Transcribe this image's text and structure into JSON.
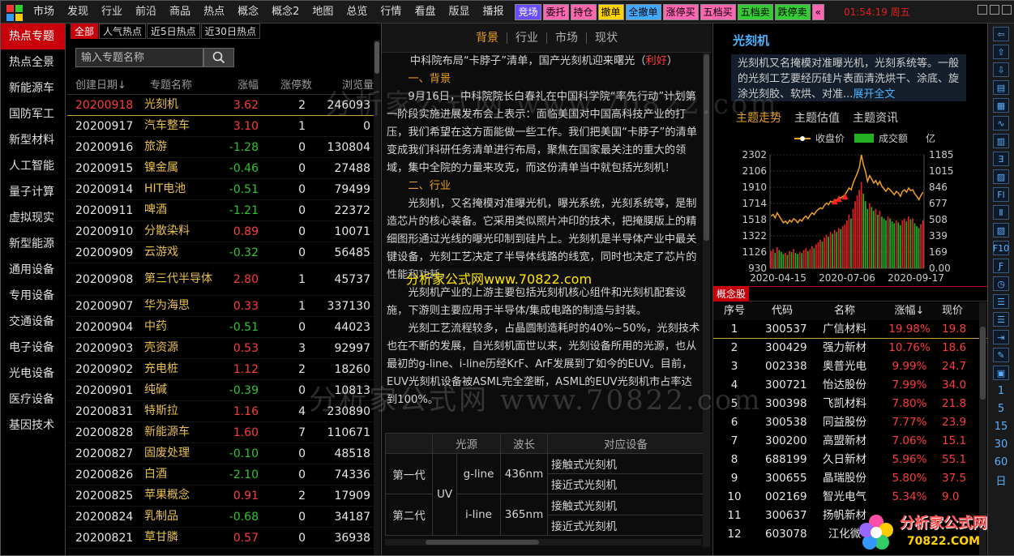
{
  "menu": [
    "市场",
    "发现",
    "行业",
    "前沿",
    "商品",
    "热点",
    "概念",
    "概念2",
    "地图",
    "总览",
    "行情",
    "看盘",
    "版显",
    "播报"
  ],
  "quick_buttons": [
    {
      "label": "竞场",
      "bg": "#6a4cff",
      "fg": "#ffffff"
    },
    {
      "label": "委托",
      "bg": "#ff66b2",
      "fg": "#000000"
    },
    {
      "label": "持仓",
      "bg": "#ff66b2",
      "fg": "#000000"
    },
    {
      "label": "撤单",
      "bg": "#ffd400",
      "fg": "#000000"
    },
    {
      "label": "全撤单",
      "bg": "#3fa9ff",
      "fg": "#000000"
    },
    {
      "label": "涨停买",
      "bg": "#ff66b2",
      "fg": "#000000"
    },
    {
      "label": "五档买",
      "bg": "#ff66b2",
      "fg": "#000000"
    },
    {
      "label": "五档卖",
      "bg": "#33cc33",
      "fg": "#000000"
    },
    {
      "label": "跌停卖",
      "bg": "#33cc33",
      "fg": "#000000"
    },
    {
      "label": "«",
      "bg": "#ff66b2",
      "fg": "#000000"
    }
  ],
  "clock": "01:54:19 周五",
  "left_nav": [
    "热点专题",
    "热点全景",
    "新能源车",
    "国防军工",
    "新型材料",
    "人工智能",
    "量子计算",
    "虚拟现实",
    "新型能源",
    "通用设备",
    "专用设备",
    "交通设备",
    "电子设备",
    "光电设备",
    "医疗设备",
    "基因技术"
  ],
  "topic_tabs": [
    "全部",
    "人气热点",
    "近5日热点",
    "近30日热点"
  ],
  "search": {
    "placeholder": "输入专题名称"
  },
  "topic_headers": [
    "创建日期↓",
    "专题名称",
    "涨幅",
    "涨停数",
    "浏览量"
  ],
  "topics": [
    {
      "date": "20200918",
      "name": "光刻机",
      "chg": "3.62",
      "limit": "2",
      "views": "246093",
      "dir": "up"
    },
    {
      "date": "20200917",
      "name": "汽车整车",
      "chg": "3.10",
      "limit": "1",
      "views": "0",
      "dir": "up"
    },
    {
      "date": "20200916",
      "name": "旅游",
      "chg": "-1.28",
      "limit": "0",
      "views": "130804",
      "dir": "dn"
    },
    {
      "date": "20200915",
      "name": "镍金属",
      "chg": "-0.46",
      "limit": "0",
      "views": "27488",
      "dir": "dn"
    },
    {
      "date": "20200914",
      "name": "HIT电池",
      "chg": "-0.51",
      "limit": "0",
      "views": "79499",
      "dir": "dn"
    },
    {
      "date": "20200911",
      "name": "啤酒",
      "chg": "-1.21",
      "limit": "0",
      "views": "22372",
      "dir": "dn"
    },
    {
      "date": "20200910",
      "name": "分散染料",
      "chg": "0.89",
      "limit": "0",
      "views": "10071",
      "dir": "up"
    },
    {
      "date": "20200909",
      "name": "云游戏",
      "chg": "-0.32",
      "limit": "0",
      "views": "56485",
      "dir": "dn"
    },
    {
      "date": "20200908",
      "name": "第三代半导体",
      "chg": "2.80",
      "limit": "1",
      "views": "45737",
      "dir": "up"
    },
    {
      "date": "20200907",
      "name": "华为海思",
      "chg": "0.33",
      "limit": "1",
      "views": "337130",
      "dir": "up"
    },
    {
      "date": "20200904",
      "name": "中药",
      "chg": "-0.51",
      "limit": "0",
      "views": "44023",
      "dir": "dn"
    },
    {
      "date": "20200903",
      "name": "壳资源",
      "chg": "0.53",
      "limit": "3",
      "views": "92997",
      "dir": "up"
    },
    {
      "date": "20200902",
      "name": "充电桩",
      "chg": "1.12",
      "limit": "2",
      "views": "18260",
      "dir": "up"
    },
    {
      "date": "20200901",
      "name": "纯碱",
      "chg": "-0.39",
      "limit": "0",
      "views": "10813",
      "dir": "dn"
    },
    {
      "date": "20200831",
      "name": "特斯拉",
      "chg": "1.16",
      "limit": "4",
      "views": "230890",
      "dir": "up"
    },
    {
      "date": "20200828",
      "name": "新能源车",
      "chg": "1.60",
      "limit": "7",
      "views": "110671",
      "dir": "up"
    },
    {
      "date": "20200827",
      "name": "固废处理",
      "chg": "-0.10",
      "limit": "0",
      "views": "48518",
      "dir": "dn"
    },
    {
      "date": "20200826",
      "name": "白酒",
      "chg": "-2.10",
      "limit": "0",
      "views": "74336",
      "dir": "dn"
    },
    {
      "date": "20200825",
      "name": "苹果概念",
      "chg": "0.91",
      "limit": "2",
      "views": "17909",
      "dir": "up"
    },
    {
      "date": "20200824",
      "name": "乳制品",
      "chg": "-0.68",
      "limit": "0",
      "views": "34187",
      "dir": "dn"
    },
    {
      "date": "20200821",
      "name": "草甘膦",
      "chg": "0.57",
      "limit": "0",
      "views": "36938",
      "dir": "up"
    }
  ],
  "article_tabs": [
    "背景",
    "行业",
    "市场",
    "现状"
  ],
  "article": {
    "title": "中科院布局“卡脖子”清单，国产光刻机迎来曙光（",
    "title_tag": "利好",
    "title_end": "）",
    "h1": "一、背景",
    "p1": "9月16日，中科院院长白春礼在中国科学院“率先行动”计划第一阶段实施进展发布会上表示：面临美国对中国高科技产业的打压，我们希望在这方面能做一些工作。我们把美国“卡脖子”的清单变成我们科研任务清单进行布局，聚焦在国家最关注的重大的领域，集中全院的力量来攻克，而这份清单当中就包括光刻机！",
    "h2": "二、行业",
    "p2": "光刻机，又名掩模对准曝光机，曝光系统，光刻系统等，是制造芯片的核心装备。它采用类似照片冲印的技术，把掩膜版上的精细图形通过光线的曝光印制到硅片上。光刻机是半导体产业中最关键设备，光刻工艺决定了半导体线路的线宽，同时也决定了芯片的性能和功耗。",
    "p3": "光刻机产业的上游主要包括光刻机核心组件和光刻机配套设施，下游则主要应用于半导体/集成电路的制造与封装。",
    "p4": "光刻工艺流程较多，占晶圆制造耗时的40%~50%，光刻技术也在不断的发展，自光刻机面世以来，光刻设备所用的光源，也从最初的g-line、i-line历经KrF、ArF发展到了如今的EUV。目前，EUV光刻机设备被ASML完全垄断，ASML的EUV光刻机市占率达到100%。"
  },
  "lith_table": {
    "headers": [
      "",
      "光源",
      "波长",
      "对应设备"
    ],
    "gen1": "第一代",
    "gen2": "第二代",
    "uv": "UV",
    "r1": {
      "src": "g-line",
      "wl": "436nm",
      "dev": "接触式光刻机"
    },
    "r2": {
      "dev": "接近式光刻机"
    },
    "r3": {
      "src": "i-line",
      "wl": "365nm",
      "dev": "接触式光刻机"
    },
    "r4": {
      "dev": "接近式光刻机"
    }
  },
  "right": {
    "title": "光刻机",
    "desc": "光刻机又名掩模对准曝光机，光刻系统等。一般的光刻工艺要经历硅片表面清洗烘干、涂底、旋涂光刻胶、软烘、对准...",
    "more": "展开全文",
    "tabs": [
      "主题走势",
      "主题估值",
      "主题资讯"
    ],
    "concept_title": "概念股",
    "stock_headers": [
      "序号",
      "代码",
      "名称",
      "涨幅↓",
      "现价"
    ],
    "stocks": [
      {
        "no": "1",
        "code": "300537",
        "name": "广信材料",
        "chg": "19.98%",
        "price": "19.8"
      },
      {
        "no": "2",
        "code": "300429",
        "name": "强力新材",
        "chg": "10.76%",
        "price": "18.6"
      },
      {
        "no": "3",
        "code": "002338",
        "name": "奥普光电",
        "chg": "9.99%",
        "price": "24.7"
      },
      {
        "no": "4",
        "code": "300721",
        "name": "怡达股份",
        "chg": "7.99%",
        "price": "34.0"
      },
      {
        "no": "5",
        "code": "300398",
        "name": "飞凯材料",
        "chg": "7.80%",
        "price": "21.8"
      },
      {
        "no": "6",
        "code": "300538",
        "name": "同益股份",
        "chg": "7.77%",
        "price": "23.9"
      },
      {
        "no": "7",
        "code": "300200",
        "name": "高盟新材",
        "chg": "7.06%",
        "price": "15.1"
      },
      {
        "no": "8",
        "code": "688199",
        "name": "久日新材",
        "chg": "5.96%",
        "price": "55.1"
      },
      {
        "no": "9",
        "code": "300655",
        "name": "晶瑞股份",
        "chg": "5.80%",
        "price": "37.5"
      },
      {
        "no": "10",
        "code": "002169",
        "name": "智光电气",
        "chg": "5.34%",
        "price": "9.0"
      },
      {
        "no": "11",
        "code": "300637",
        "name": "扬帆新材",
        "chg": "",
        "price": ""
      },
      {
        "no": "12",
        "code": "603078",
        "name": "江化微",
        "chg": "",
        "price": ""
      }
    ]
  },
  "chart_data": {
    "type": "line",
    "legend": [
      "收盘价",
      "成交额"
    ],
    "unit_right": "亿",
    "y_left_ticks": [
      "2302",
      "2106",
      "1910",
      "1714",
      "1518",
      "1322",
      "1126",
      "930"
    ],
    "y_right_ticks": [
      "1185",
      "1015",
      "846",
      "677",
      "508",
      "339",
      "169",
      "0.00"
    ],
    "x_ticks": [
      "2020-04-15",
      "2020-07-06",
      "2020-09-17"
    ],
    "ylim_left": [
      930,
      2302
    ],
    "ylim_right": [
      0,
      1185
    ],
    "price": [
      1560,
      1580,
      1540,
      1600,
      1560,
      1520,
      1480,
      1500,
      1470,
      1510,
      1490,
      1530,
      1510,
      1480,
      1520,
      1500,
      1540,
      1560,
      1530,
      1570,
      1600,
      1580,
      1620,
      1640,
      1660,
      1650,
      1690,
      1720,
      1700,
      1740,
      1730,
      1760,
      1750,
      1790,
      1780,
      1800,
      1820,
      1860,
      1900,
      1880,
      1960,
      2020,
      2080,
      2150,
      2302,
      2180,
      2100,
      1980,
      2050,
      2010,
      1960,
      1990,
      1940,
      1980,
      1920,
      1890,
      1860,
      1900,
      1880,
      1850,
      1820,
      1860,
      1840,
      1800,
      1860,
      1880,
      1850,
      1900,
      1870,
      1880,
      1830,
      1800,
      1760,
      1810,
      1850
    ],
    "volume": [
      180,
      200,
      160,
      220,
      190,
      170,
      150,
      160,
      140,
      180,
      170,
      200,
      160,
      150,
      170,
      160,
      190,
      210,
      180,
      200,
      230,
      210,
      250,
      270,
      300,
      280,
      320,
      350,
      330,
      380,
      360,
      400,
      380,
      420,
      410,
      440,
      460,
      500,
      560,
      520,
      620,
      700,
      760,
      820,
      900,
      780,
      700,
      620,
      680,
      640,
      600,
      620,
      560,
      600,
      540,
      520,
      500,
      540,
      520,
      490,
      470,
      500,
      480,
      450,
      500,
      520,
      490,
      540,
      510,
      520,
      470,
      440,
      420,
      460,
      500
    ],
    "markers": [
      {
        "index": 31
      },
      {
        "index": 33
      },
      {
        "index": 36
      }
    ]
  },
  "tools": [
    "⇦",
    "⇧",
    "⇩",
    "▤",
    "▦",
    "∿",
    "▥",
    "Ǝ",
    "▧",
    "Fl",
    "Ⅱ",
    "▨",
    "F10",
    "Ƒ",
    "◷",
    "☰",
    "☰",
    "⇥",
    "✎",
    "▣",
    "1",
    "5",
    "15",
    "30",
    "60",
    "日"
  ],
  "watermark": "分析家公式网www.70822.com",
  "watermark_bg": "分析家公式网 www.70822.com",
  "brand": {
    "line1": "分析家公式网",
    "line2": "70822.COM"
  },
  "colors": {
    "up": "#ff3b3b",
    "down": "#2ec42e",
    "accent": "#e8a020",
    "active": "#c8000a",
    "price_line": "#f0a020",
    "volume_up": "#e02020",
    "volume_dn": "#22b022"
  }
}
